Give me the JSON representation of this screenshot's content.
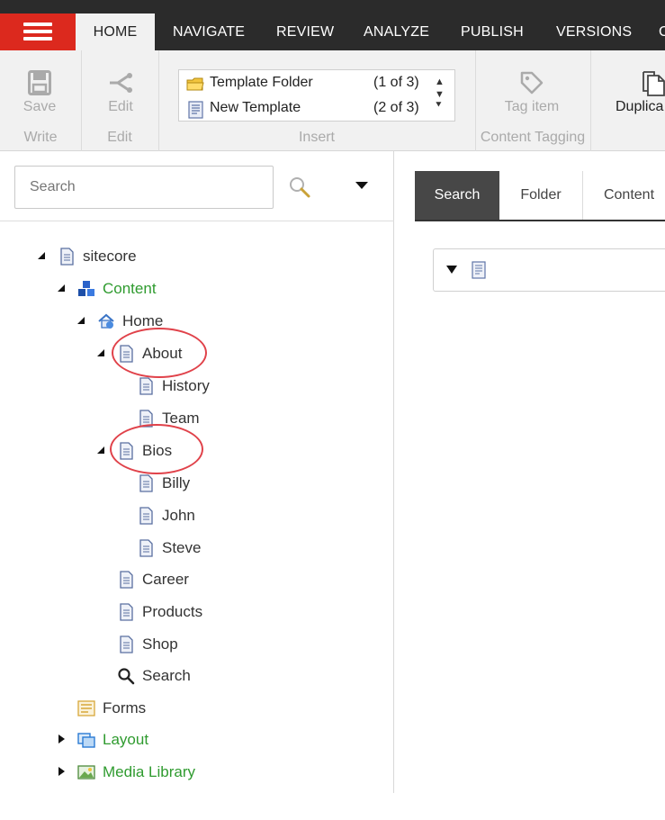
{
  "menu": {
    "tabs": [
      "HOME",
      "NAVIGATE",
      "REVIEW",
      "ANALYZE",
      "PUBLISH",
      "VERSIONS",
      "C"
    ],
    "active_tab": "HOME"
  },
  "ribbon": {
    "save_label": "Save",
    "write_group": "Write",
    "edit_button": "Edit",
    "edit_group": "Edit",
    "insert_group": "Insert",
    "insert_items": [
      {
        "name": "Template Folder",
        "count": "(1 of 3)",
        "icon": "folder-icon"
      },
      {
        "name": "New Template",
        "count": "(2 of 3)",
        "icon": "template-icon"
      }
    ],
    "tag_item": "Tag item",
    "content_tagging_group": "Content Tagging",
    "duplicate_label": "Duplica"
  },
  "left": {
    "search_placeholder": "Search"
  },
  "tree": [
    {
      "label": "sitecore",
      "expanded": true,
      "color": "dark",
      "icon": "page-icon"
    },
    {
      "label": "Content",
      "expanded": true,
      "color": "green",
      "icon": "cubes-icon"
    },
    {
      "label": "Home",
      "expanded": true,
      "color": "dark",
      "icon": "home-icon"
    },
    {
      "label": "About",
      "expanded": true,
      "color": "dark",
      "icon": "page-icon",
      "highlighted": true
    },
    {
      "label": "History",
      "color": "dark",
      "icon": "page-icon"
    },
    {
      "label": "Team",
      "color": "dark",
      "icon": "page-icon"
    },
    {
      "label": "Bios",
      "expanded": true,
      "color": "dark",
      "icon": "page-icon",
      "highlighted": true
    },
    {
      "label": "Billy",
      "color": "dark",
      "icon": "page-icon"
    },
    {
      "label": "John",
      "color": "dark",
      "icon": "page-icon"
    },
    {
      "label": "Steve",
      "color": "dark",
      "icon": "page-icon"
    },
    {
      "label": "Career",
      "color": "dark",
      "icon": "page-icon"
    },
    {
      "label": "Products",
      "color": "dark",
      "icon": "page-icon"
    },
    {
      "label": "Shop",
      "color": "dark",
      "icon": "page-icon"
    },
    {
      "label": "Search",
      "color": "dark",
      "icon": "magnifier-icon"
    },
    {
      "label": "Forms",
      "color": "dark",
      "icon": "forms-icon"
    },
    {
      "label": "Layout",
      "expanded": false,
      "color": "green",
      "icon": "layout-icon"
    },
    {
      "label": "Media Library",
      "expanded": false,
      "color": "green",
      "icon": "media-icon"
    }
  ],
  "right": {
    "tabs": [
      "Search",
      "Folder",
      "Content"
    ],
    "active_tab": "Search"
  },
  "colors": {
    "menubar": "#2b2b2b",
    "accent_red": "#dc291e",
    "green_text": "#2f9b2f",
    "highlight_circle": "#e0424a"
  }
}
